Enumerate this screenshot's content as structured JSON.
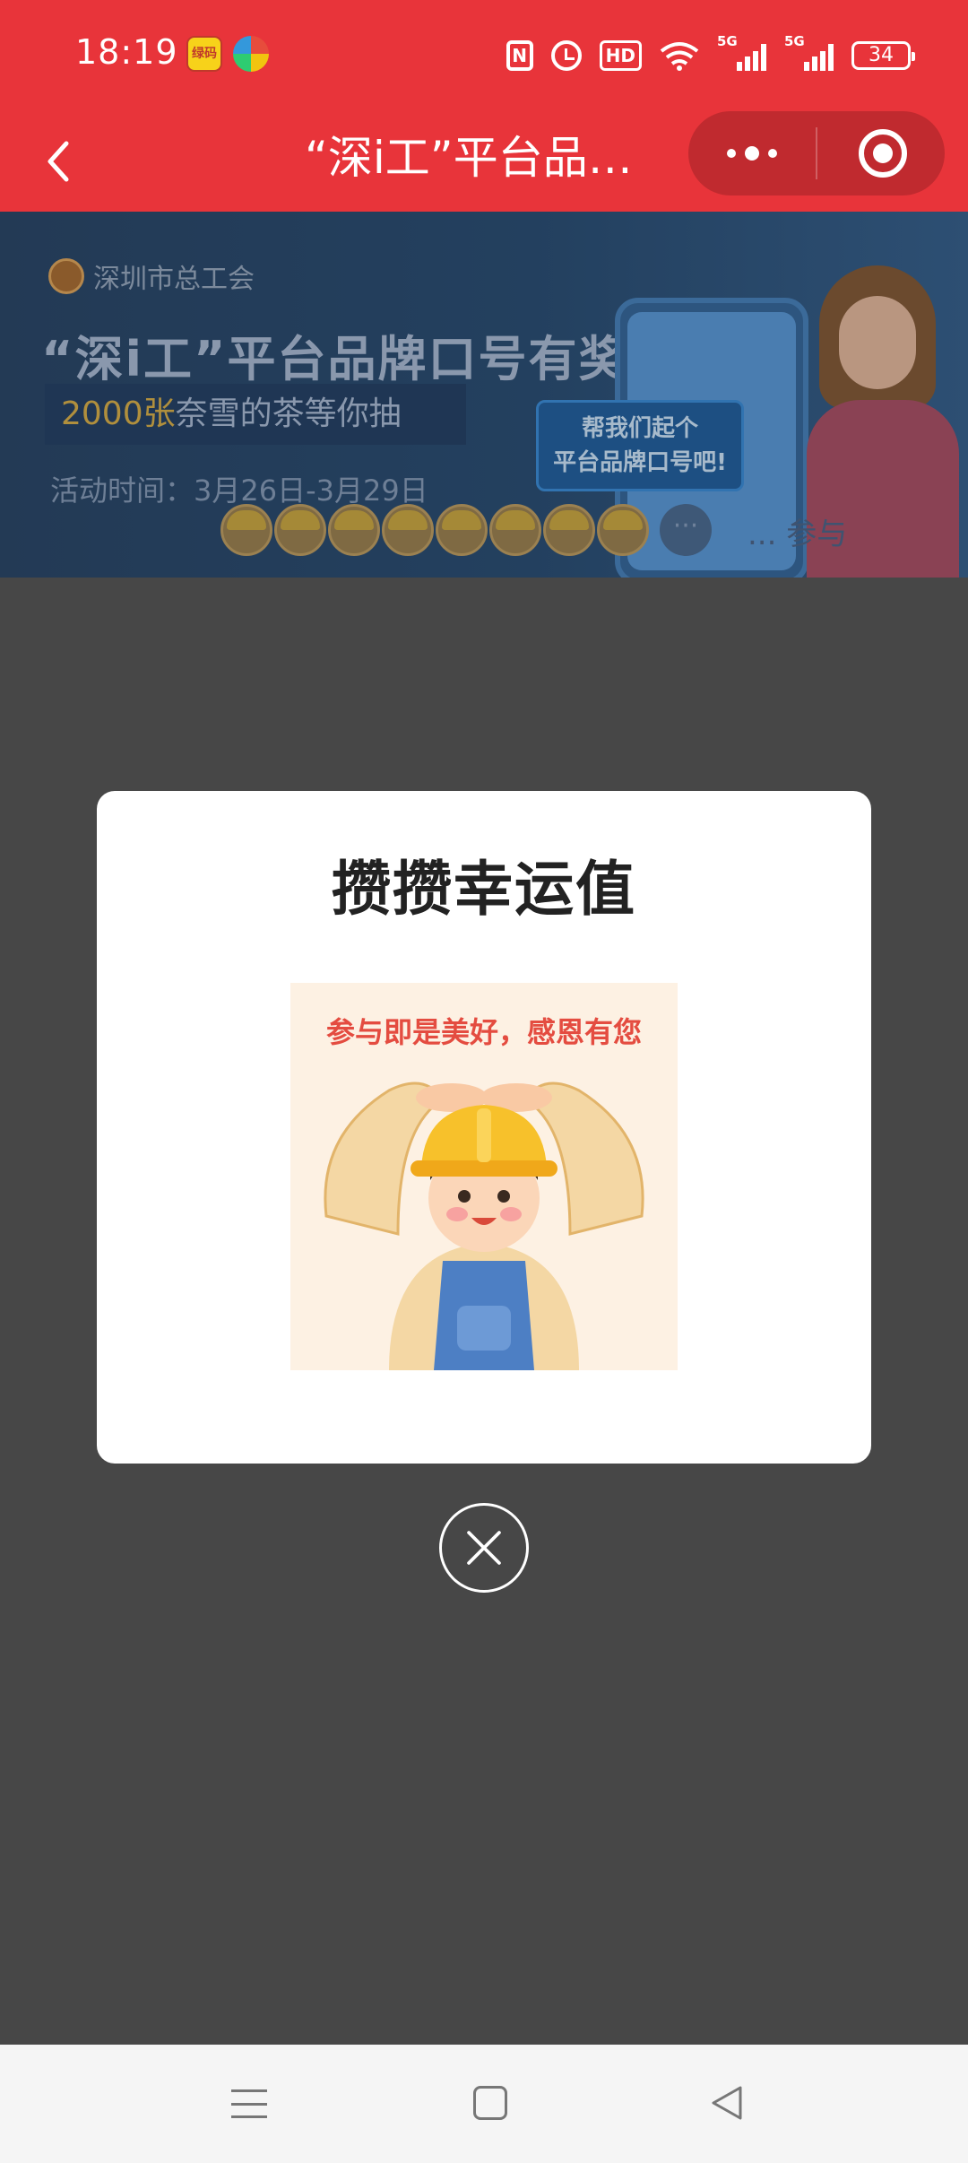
{
  "status_bar": {
    "time": "18:19",
    "app_icon_1_text": "绿码",
    "hd_label": "HD",
    "signal_1_label": "5G",
    "signal_2_label": "5G",
    "battery": "34"
  },
  "nav": {
    "title": "“深i工”平台品牌..."
  },
  "banner": {
    "org": "深圳市总工会",
    "title": "“深i工”平台品牌口号有奖征集",
    "prize_highlight": "2000张",
    "prize_rest": "奈雪的茶等你抽",
    "time": "活动时间：3月26日-3月29日",
    "bubble_line1": "帮我们起个",
    "bubble_line2": "平台品牌口号吧!",
    "participants": "...  参与"
  },
  "dialog": {
    "title": "攒攒幸运值",
    "image_caption": "参与即是美好，感恩有您"
  },
  "colors": {
    "header_red": "#e8343a",
    "overlay": "#474747",
    "caption_red": "#e44c40"
  },
  "icons": [
    "back-chevron-icon",
    "more-dots-icon",
    "miniprogram-close-icon",
    "close-circle-icon",
    "menu-icon",
    "home-icon",
    "back-triangle-icon"
  ]
}
